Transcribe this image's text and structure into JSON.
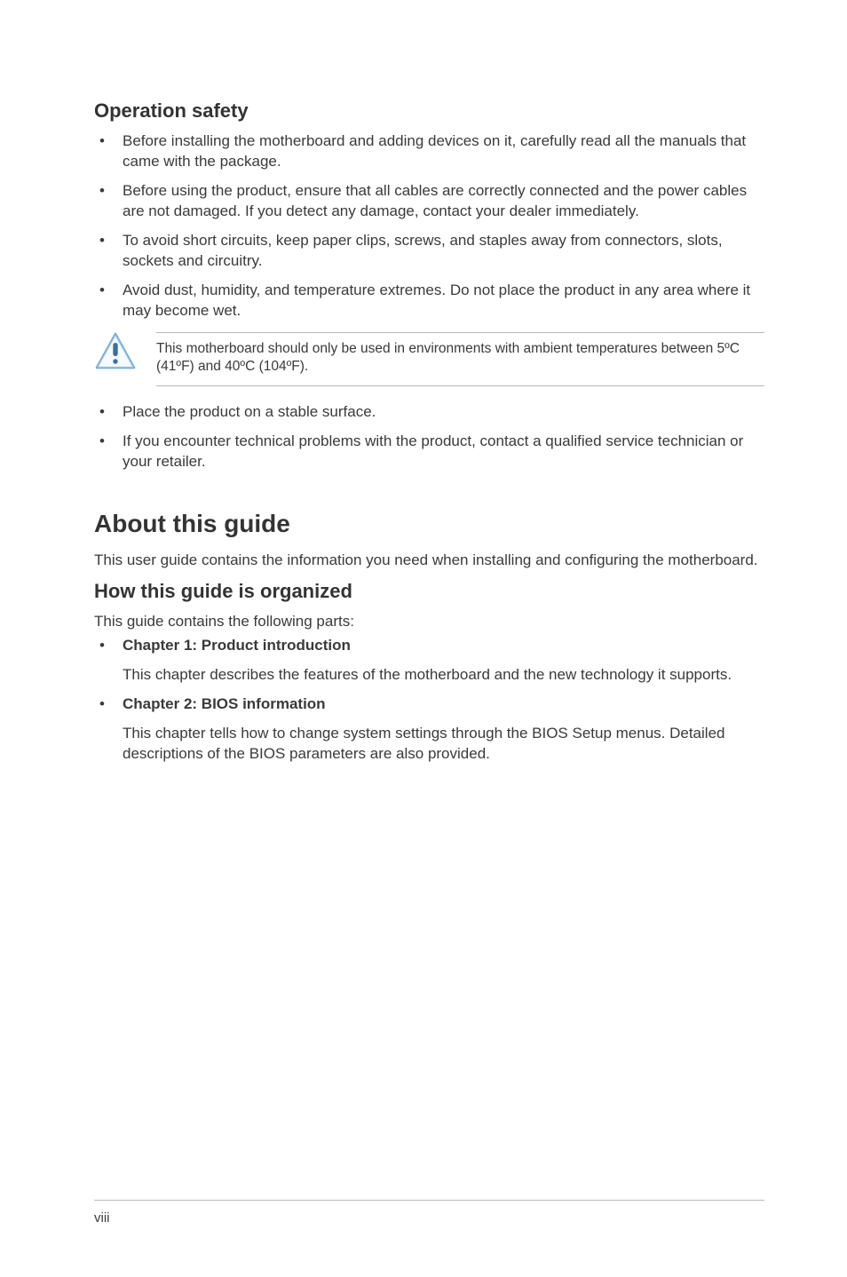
{
  "sections": {
    "operation_safety": {
      "heading": "Operation safety",
      "bullets_top": [
        "Before installing the motherboard and adding devices on it, carefully read all the manuals that came with the package.",
        "Before using the product, ensure that all cables are correctly connected and the power cables are not damaged. If you detect any damage, contact your dealer immediately.",
        "To avoid short circuits, keep paper clips, screws, and staples away from connectors, slots, sockets and circuitry.",
        "Avoid dust, humidity, and temperature extremes. Do not place the product in any area where it may become wet."
      ],
      "callout": "This motherboard should only be used in environments with ambient temperatures between 5ºC (41ºF) and 40ºC (104ºF).",
      "bullets_bottom": [
        "Place the product on a stable surface.",
        "If you encounter technical problems with the product, contact a qualified service technician or your retailer."
      ]
    },
    "about_guide": {
      "heading": "About this guide",
      "intro": "This user guide contains the information you need when installing and configuring the motherboard.",
      "organized": {
        "heading": "How this guide is organized",
        "intro": "This guide contains the following parts:",
        "items": [
          {
            "title": "Chapter 1: Product introduction",
            "desc": "This chapter describes the features of the motherboard and the new technology it supports."
          },
          {
            "title": "Chapter 2: BIOS information",
            "desc": "This chapter tells how to change system settings through the BIOS Setup menus. Detailed descriptions of the BIOS parameters are also provided."
          }
        ]
      }
    }
  },
  "footer": {
    "page": "viii"
  }
}
